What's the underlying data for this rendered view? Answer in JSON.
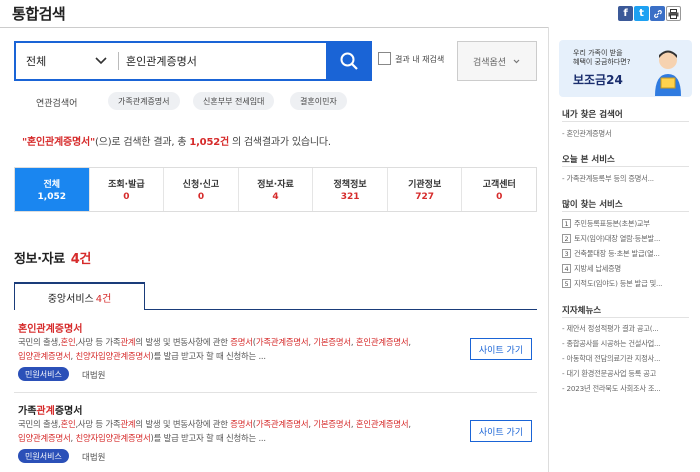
{
  "header": {
    "title": "통합검색"
  },
  "search": {
    "scope": "전체",
    "query": "혼인관계증명서",
    "refine_label": "결과 내 재검색",
    "options_label": "검색옵션"
  },
  "related": {
    "label": "연관검색어",
    "tags": [
      "가족관계증명서",
      "신혼부부 전세임대",
      "결혼이민자"
    ]
  },
  "summary": {
    "query": "\"혼인관계증명서\"",
    "prefix": "(으)로 검색한 결과, 총 ",
    "count": "1,052건",
    "suffix": " 의 검색결과가 있습니다."
  },
  "categories": [
    {
      "label": "전체",
      "count": "1,052"
    },
    {
      "label": "조회·발급",
      "count": "0"
    },
    {
      "label": "신청·신고",
      "count": "0"
    },
    {
      "label": "정보·자료",
      "count": "4"
    },
    {
      "label": "정책정보",
      "count": "321"
    },
    {
      "label": "기관정보",
      "count": "727"
    },
    {
      "label": "고객센터",
      "count": "0"
    }
  ],
  "section": {
    "title": "정보·자료",
    "count": "4건",
    "subtab_label": "중앙서비스",
    "subtab_count": "4건"
  },
  "results": [
    {
      "title_hl": "혼인관계증명서",
      "line1": "국민의 출생,혼인,사망 등 가족관계의 발생 및 변동사항에 관한 증명서(가족관계증명서, 기본증명서, 혼인관계증명서,",
      "line2": "입양관계증명서, 친양자입양관계증명서)를 발급 받고자 할 때 신청하는 ...",
      "badge": "민원서비스",
      "org": "대법원",
      "button": "사이트 가기"
    },
    {
      "title_pre": "가족",
      "title_hl": "관계",
      "title_post": "증명서",
      "line1": "국민의 출생,혼인,사망 등 가족관계의 발생 및 변동사항에 관한 증명서(가족관계증명서, 기본증명서, 혼인관계증명서,",
      "line2": "입양관계증명서, 친양자입양관계증명서)를 발급 받고자 할 때 신청하는 ...",
      "badge": "민원서비스",
      "org": "대법원",
      "button": "사이트 가기"
    }
  ],
  "banner": {
    "line1": "우리 가족이 받을",
    "line2": "혜택이 궁금하다면?",
    "brand": "보조금24"
  },
  "sidebar": {
    "my_searches": {
      "title": "내가 찾은 검색어",
      "items": [
        "혼인관계증명서"
      ]
    },
    "today_services": {
      "title": "오늘 본 서비스",
      "items": [
        "가족관계등록부 등의 증명서..."
      ]
    },
    "popular": {
      "title": "많이 찾는 서비스",
      "items": [
        "주민등록표등본(초본)교부",
        "토지(임야)대장 열람·등본발...",
        "건축물대장 등·초본 발급(열...",
        "지방세 납세증명",
        "지적도(임야도) 등본 발급 및..."
      ]
    },
    "local_news": {
      "title": "지자체뉴스",
      "items": [
        "제안서 정성적평가 결과 공고(...",
        "종합공사를 시공하는 건설사업...",
        "아동학대 전담의료기관 지정사...",
        "대기 환경전문공사업 등록 공고",
        "2023년 전라북도 사회조사 조..."
      ]
    }
  },
  "colors": {
    "primary": "#1a64d6",
    "active_tab": "#1a86f0",
    "highlight": "#d62b2b",
    "badge": "#2b50b8"
  }
}
